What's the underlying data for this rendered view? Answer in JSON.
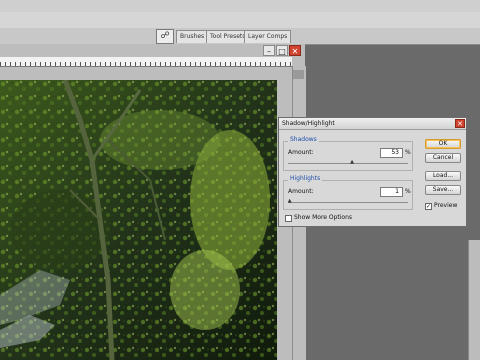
{
  "palette_well": {
    "icon": "palette-well-icon",
    "tabs": [
      {
        "label": "Brushes"
      },
      {
        "label": "Tool Presets"
      },
      {
        "label": "Layer Comps"
      }
    ]
  },
  "document": {
    "photo": {
      "icon": "forest-photo",
      "colors": {
        "dark": "#1c2a14",
        "moss": "#6f9a2c",
        "light_moss": "#b6cf62",
        "water": "#c7d1d8"
      }
    }
  },
  "dialog": {
    "title": "Shadow/Highlight",
    "shadows": {
      "legend": "Shadows",
      "amount_label": "Amount:",
      "amount_value": "53",
      "unit": "%",
      "slider_level": 0.53
    },
    "highlights": {
      "legend": "Highlights",
      "amount_label": "Amount:",
      "amount_value": "1",
      "unit": "%",
      "slider_level": 0.01
    },
    "buttons": {
      "ok": "OK",
      "cancel": "Cancel",
      "load": "Load...",
      "save": "Save..."
    },
    "preview": {
      "label": "Preview",
      "checked": true
    },
    "show_more": {
      "label": "Show More Options",
      "checked": false
    }
  },
  "colors": {
    "workspace": "#6a6a6a",
    "dialog_bg": "#d8d8d8",
    "legend_blue": "#1f4fa8",
    "close_red": "#d0442f",
    "ok_focus": "#f3c25b"
  }
}
